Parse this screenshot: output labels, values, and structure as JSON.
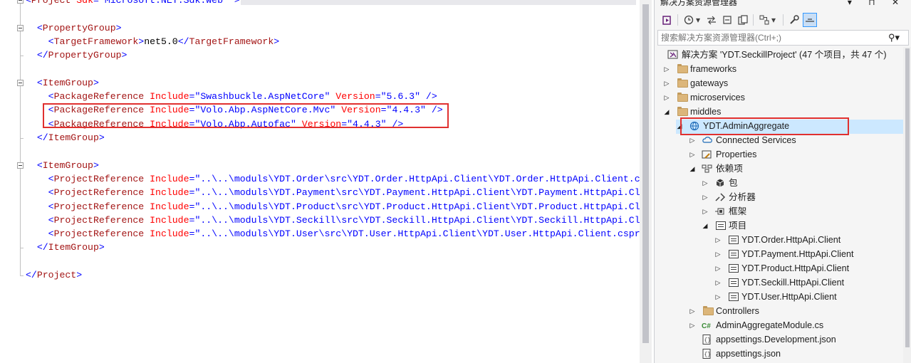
{
  "editor": {
    "lines": [
      {
        "id": "l0",
        "parts": [
          [
            "p",
            "<"
          ],
          [
            "t",
            "Project"
          ],
          [
            "a",
            " Sdk"
          ],
          [
            "p",
            "="
          ],
          [
            "v",
            "\"Microsoft.NET.Sdk.Web\""
          ],
          [
            "p",
            " >"
          ]
        ]
      },
      {
        "id": "l1",
        "parts": []
      },
      {
        "id": "l2",
        "parts": [
          [
            "p",
            "  <"
          ],
          [
            "t",
            "PropertyGroup"
          ],
          [
            "p",
            ">"
          ]
        ]
      },
      {
        "id": "l3",
        "parts": [
          [
            "p",
            "    <"
          ],
          [
            "t",
            "TargetFramework"
          ],
          [
            "p",
            ">"
          ],
          [
            "txt",
            "net5.0"
          ],
          [
            "p",
            "</"
          ],
          [
            "t",
            "TargetFramework"
          ],
          [
            "p",
            ">"
          ]
        ]
      },
      {
        "id": "l4",
        "parts": [
          [
            "p",
            "  </"
          ],
          [
            "t",
            "PropertyGroup"
          ],
          [
            "p",
            ">"
          ]
        ]
      },
      {
        "id": "l5",
        "parts": []
      },
      {
        "id": "l6",
        "parts": [
          [
            "p",
            "  <"
          ],
          [
            "t",
            "ItemGroup"
          ],
          [
            "p",
            ">"
          ]
        ]
      },
      {
        "id": "l7",
        "parts": [
          [
            "p",
            "    <"
          ],
          [
            "t",
            "PackageReference"
          ],
          [
            "a",
            " Include"
          ],
          [
            "p",
            "="
          ],
          [
            "v",
            "\"Swashbuckle.AspNetCore\""
          ],
          [
            "a",
            " Version"
          ],
          [
            "p",
            "="
          ],
          [
            "v",
            "\"5.6.3\""
          ],
          [
            "p",
            " />"
          ]
        ]
      },
      {
        "id": "l8",
        "parts": [
          [
            "p",
            "    <"
          ],
          [
            "t",
            "PackageReference"
          ],
          [
            "a",
            " Include"
          ],
          [
            "p",
            "="
          ],
          [
            "v",
            "\"Volo.Abp.AspNetCore.Mvc\""
          ],
          [
            "a",
            " Version"
          ],
          [
            "p",
            "="
          ],
          [
            "v",
            "\"4.4.3\""
          ],
          [
            "p",
            " />"
          ]
        ]
      },
      {
        "id": "l9",
        "parts": [
          [
            "p",
            "    <"
          ],
          [
            "t",
            "PackageReference"
          ],
          [
            "a",
            " Include"
          ],
          [
            "p",
            "="
          ],
          [
            "v",
            "\"Volo.Abp.Autofac\""
          ],
          [
            "a",
            " Version"
          ],
          [
            "p",
            "="
          ],
          [
            "v",
            "\"4.4.3\""
          ],
          [
            "p",
            " />"
          ]
        ]
      },
      {
        "id": "l10",
        "parts": [
          [
            "p",
            "  </"
          ],
          [
            "t",
            "ItemGroup"
          ],
          [
            "p",
            ">"
          ]
        ]
      },
      {
        "id": "l11",
        "parts": []
      },
      {
        "id": "l12",
        "parts": [
          [
            "p",
            "  <"
          ],
          [
            "t",
            "ItemGroup"
          ],
          [
            "p",
            ">"
          ]
        ]
      },
      {
        "id": "l13",
        "parts": [
          [
            "p",
            "    <"
          ],
          [
            "t",
            "ProjectReference"
          ],
          [
            "a",
            " Include"
          ],
          [
            "p",
            "="
          ],
          [
            "v",
            "\"..\\..\\moduls\\YDT.Order\\src\\YDT.Order.HttpApi.Client\\YDT.Order.HttpApi.Client.csproj\""
          ]
        ]
      },
      {
        "id": "l14",
        "parts": [
          [
            "p",
            "    <"
          ],
          [
            "t",
            "ProjectReference"
          ],
          [
            "a",
            " Include"
          ],
          [
            "p",
            "="
          ],
          [
            "v",
            "\"..\\..\\moduls\\YDT.Payment\\src\\YDT.Payment.HttpApi.Client\\YDT.Payment.HttpApi.Client.csproj\""
          ]
        ]
      },
      {
        "id": "l15",
        "parts": [
          [
            "p",
            "    <"
          ],
          [
            "t",
            "ProjectReference"
          ],
          [
            "a",
            " Include"
          ],
          [
            "p",
            "="
          ],
          [
            "v",
            "\"..\\..\\moduls\\YDT.Product\\src\\YDT.Product.HttpApi.Client\\YDT.Product.HttpApi.Client.csproj\""
          ]
        ]
      },
      {
        "id": "l16",
        "parts": [
          [
            "p",
            "    <"
          ],
          [
            "t",
            "ProjectReference"
          ],
          [
            "a",
            " Include"
          ],
          [
            "p",
            "="
          ],
          [
            "v",
            "\"..\\..\\moduls\\YDT.Seckill\\src\\YDT.Seckill.HttpApi.Client\\YDT.Seckill.HttpApi.Client.csproj\""
          ]
        ]
      },
      {
        "id": "l17",
        "parts": [
          [
            "p",
            "    <"
          ],
          [
            "t",
            "ProjectReference"
          ],
          [
            "a",
            " Include"
          ],
          [
            "p",
            "="
          ],
          [
            "v",
            "\"..\\..\\moduls\\YDT.User\\src\\YDT.User.HttpApi.Client\\YDT.User.HttpApi.Client.csproj\""
          ]
        ]
      },
      {
        "id": "l18",
        "parts": [
          [
            "p",
            "  </"
          ],
          [
            "t",
            "ItemGroup"
          ],
          [
            "p",
            ">"
          ]
        ]
      },
      {
        "id": "l19",
        "parts": []
      },
      {
        "id": "l20",
        "parts": [
          [
            "p",
            "</"
          ],
          [
            "t",
            "Project"
          ],
          [
            "p",
            ">"
          ]
        ]
      }
    ]
  },
  "explorer": {
    "title": "解决方案资源管理器",
    "title_buttons": "▾ ⊓ ✕",
    "search_placeholder": "搜索解决方案资源管理器(Ctrl+;)",
    "solution_label": "解决方案 'YDT.SeckillProject' (47 个项目，共 47 个)",
    "tree": [
      {
        "label": "frameworks",
        "icon": "folder-icon",
        "arrow": "right"
      },
      {
        "label": "gateways",
        "icon": "folder-icon",
        "arrow": "right"
      },
      {
        "label": "microservices",
        "icon": "folder-icon",
        "arrow": "right"
      },
      {
        "label": "middles",
        "icon": "folder-icon",
        "arrow": "down"
      },
      {
        "label": "YDT.AdminAggregate",
        "icon": "web-project-icon",
        "arrow": "down"
      },
      {
        "label": "Connected Services",
        "icon": "connected-services-icon",
        "arrow": "right"
      },
      {
        "label": "Properties",
        "icon": "properties-icon",
        "arrow": "right"
      },
      {
        "label": "依赖项",
        "icon": "dependencies-icon",
        "arrow": "down"
      },
      {
        "label": "包",
        "icon": "package-icon",
        "arrow": "right"
      },
      {
        "label": "分析器",
        "icon": "analyzer-icon",
        "arrow": "right"
      },
      {
        "label": "框架",
        "icon": "framework-icon",
        "arrow": "right"
      },
      {
        "label": "项目",
        "icon": "project-ref-icon",
        "arrow": "down"
      },
      {
        "label": "YDT.Order.HttpApi.Client",
        "icon": "project-ref-icon",
        "arrow": "right"
      },
      {
        "label": "YDT.Payment.HttpApi.Client",
        "icon": "project-ref-icon",
        "arrow": "right"
      },
      {
        "label": "YDT.Product.HttpApi.Client",
        "icon": "project-ref-icon",
        "arrow": "right"
      },
      {
        "label": "YDT.Seckill.HttpApi.Client",
        "icon": "project-ref-icon",
        "arrow": "right"
      },
      {
        "label": "YDT.User.HttpApi.Client",
        "icon": "project-ref-icon",
        "arrow": "right"
      },
      {
        "label": "Controllers",
        "icon": "folder-icon",
        "arrow": "right"
      },
      {
        "label": "AdminAggregateModule.cs",
        "icon": "csharp-file-icon",
        "arrow": "right"
      },
      {
        "label": "appsettings.Development.json",
        "icon": "json-file-icon",
        "arrow": "none"
      },
      {
        "label": "appsettings.json",
        "icon": "json-file-icon",
        "arrow": "none"
      }
    ]
  },
  "colors": {
    "highlight_border": "#e0302f",
    "selected_row": "#cce8ff",
    "tag": "#a31515",
    "attr": "#ff0000",
    "value": "#0000ff"
  }
}
